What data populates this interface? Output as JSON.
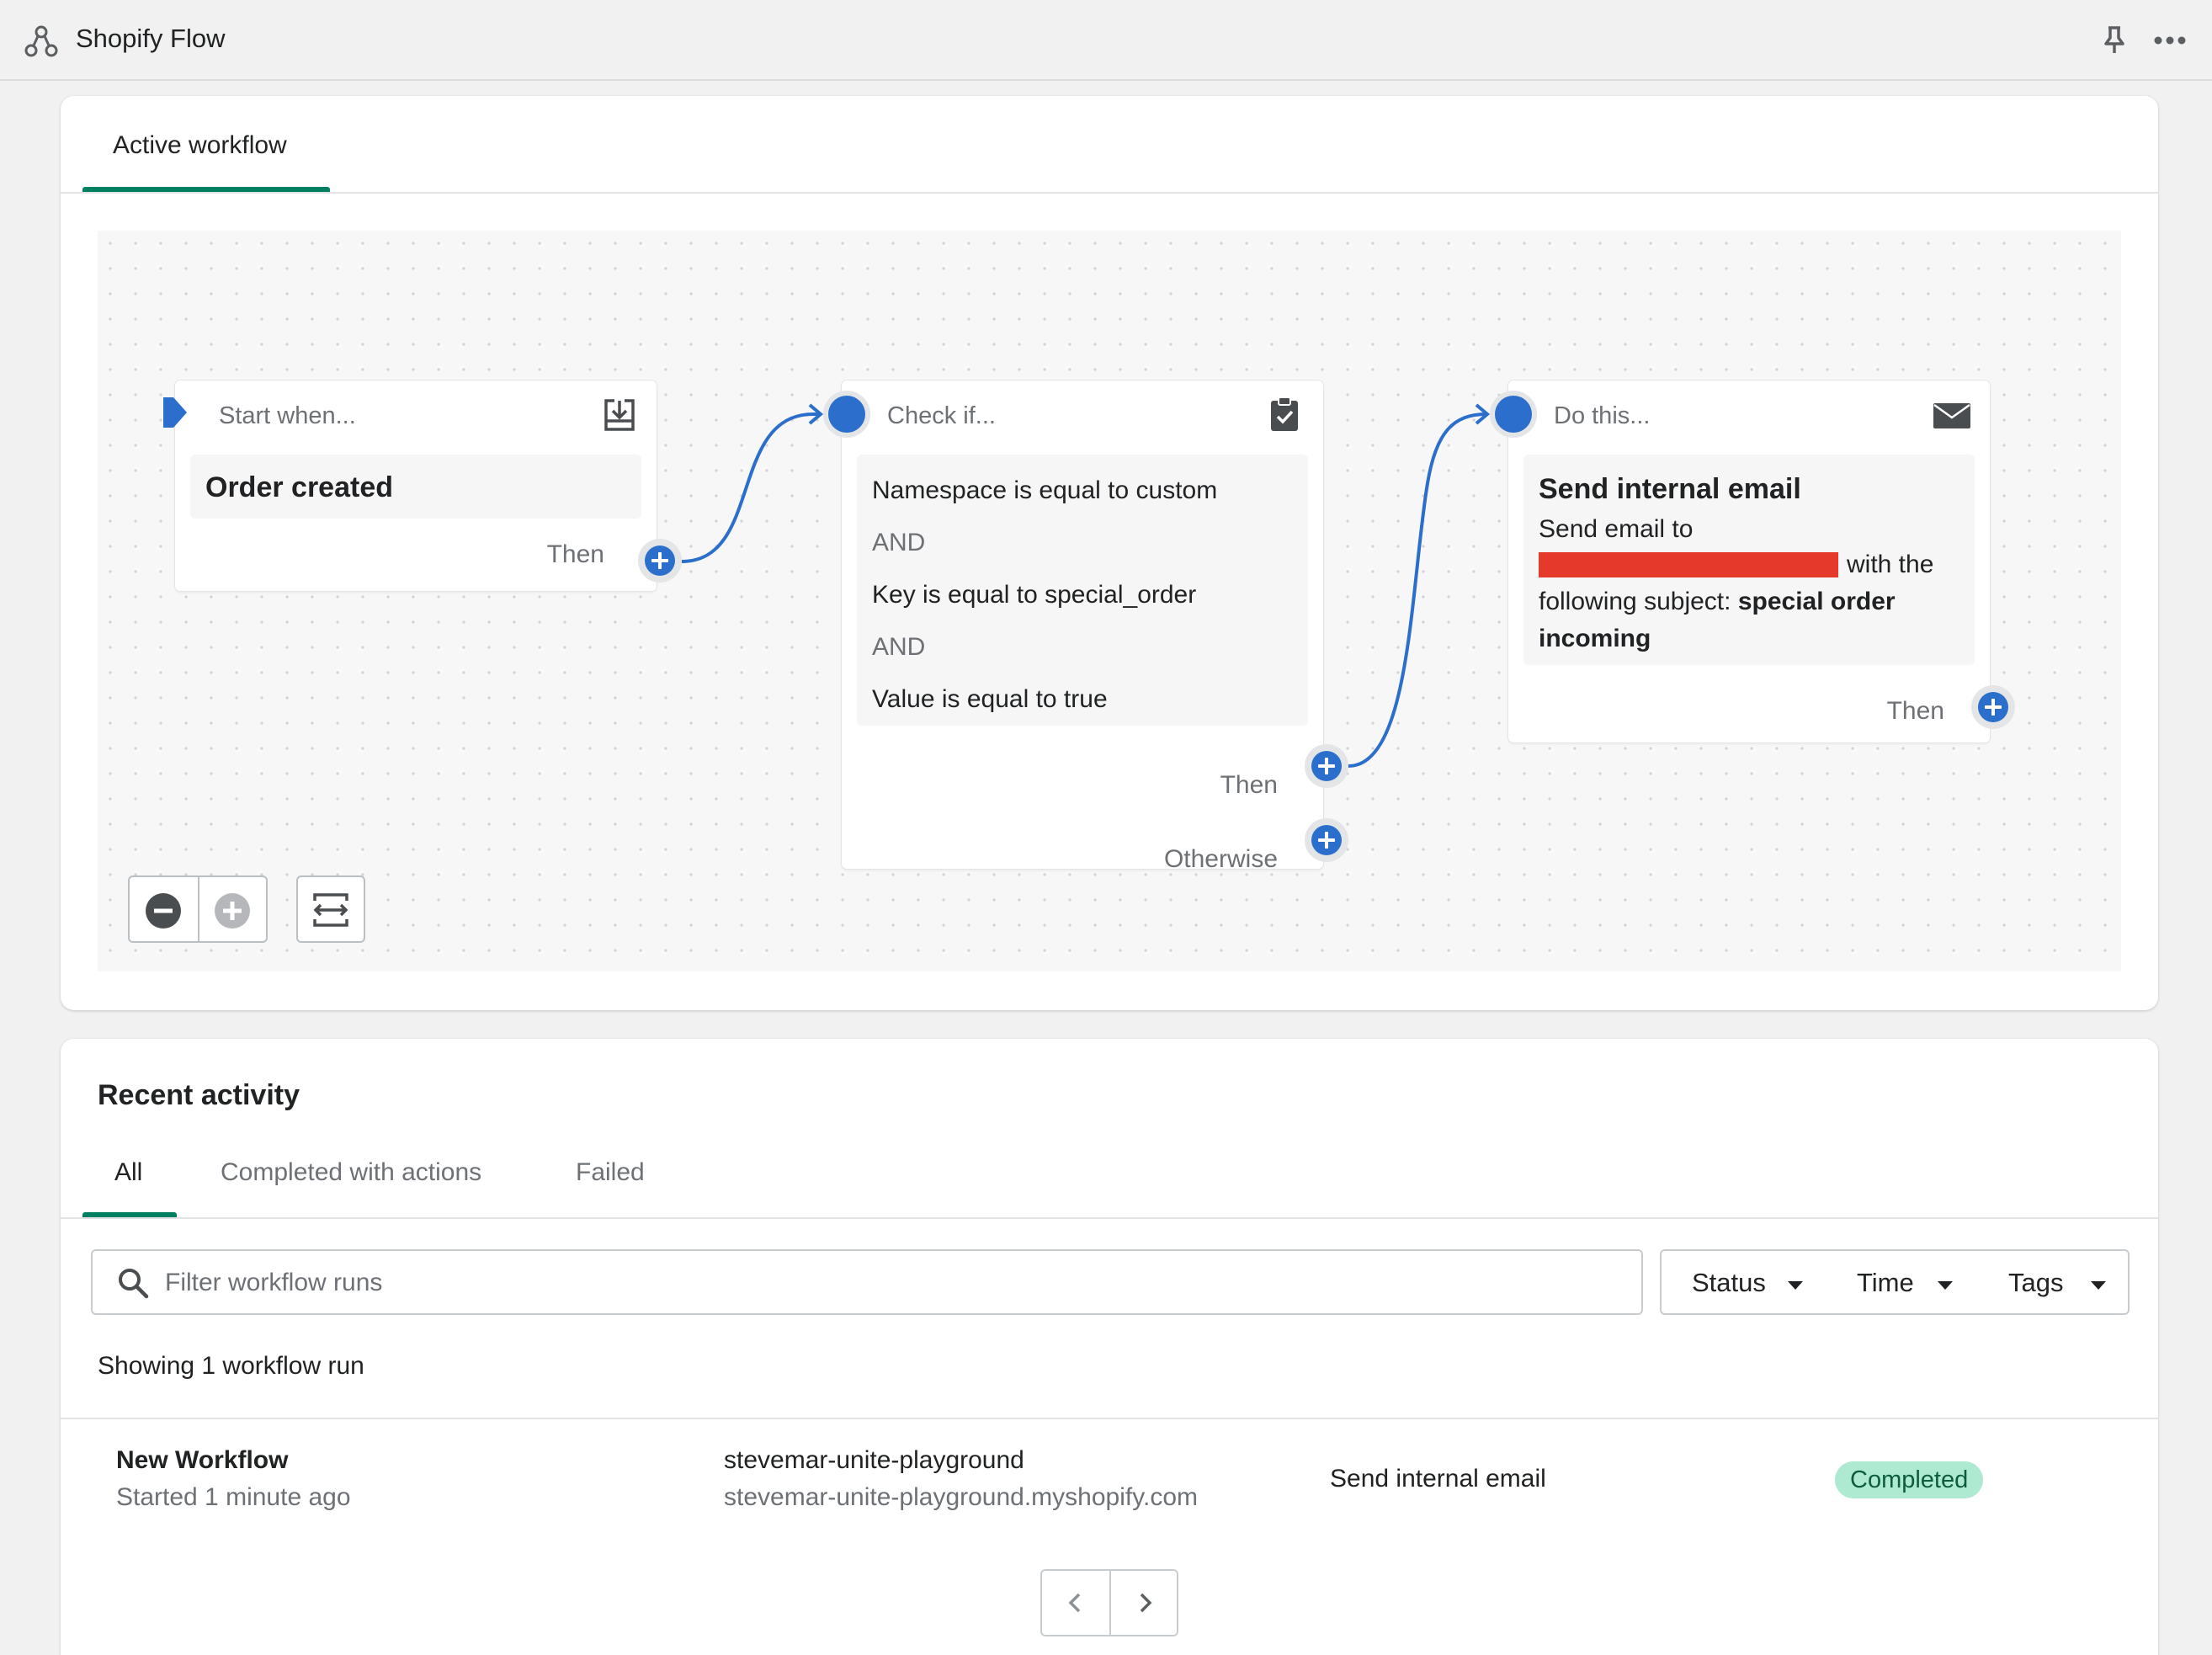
{
  "app": {
    "title": "Shopify Flow"
  },
  "workflow_card": {
    "tab_label": "Active workflow",
    "nodes": {
      "trigger": {
        "header": "Start when...",
        "title": "Order created",
        "then_label": "Then"
      },
      "condition": {
        "header": "Check if...",
        "lines": [
          "Namespace is equal to custom",
          "AND",
          "Key is equal to special_order",
          "AND",
          "Value is equal to true"
        ],
        "then_label": "Then",
        "otherwise_label": "Otherwise"
      },
      "action": {
        "header": "Do this...",
        "title": "Send internal email",
        "text_1": "Send email to",
        "text_2": "with the",
        "text_3": "following subject:",
        "subject_1": "special order",
        "subject_2": "incoming",
        "then_label": "Then"
      }
    }
  },
  "recent_activity": {
    "title": "Recent activity",
    "tabs": [
      "All",
      "Completed with actions",
      "Failed"
    ],
    "search_placeholder": "Filter workflow runs",
    "filters": [
      "Status",
      "Time",
      "Tags"
    ],
    "showing_text": "Showing 1 workflow run",
    "rows": [
      {
        "workflow_name": "New Workflow",
        "started": "Started 1 minute ago",
        "shop_name": "stevemar-unite-playground",
        "shop_domain": "stevemar-unite-playground.myshopify.com",
        "action": "Send internal email",
        "status": "Completed"
      }
    ]
  },
  "colors": {
    "accent": "#2c6ecb",
    "tab_underline": "#008060",
    "badge_bg": "#aee9d1",
    "redaction": "#e5392b"
  }
}
